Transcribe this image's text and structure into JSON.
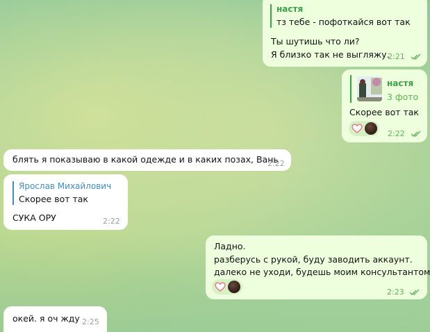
{
  "messages": [
    {
      "reply_name": "настя",
      "reply_text": "тз тебе - пофоткайся вот так",
      "line1": "Ты шутишь что ли?",
      "line2": "Я близко так не выгляжу.",
      "time": "2:21"
    },
    {
      "reply_name": "настя",
      "reply_sub": "3 фото",
      "text": "Скорее вот так",
      "time": "2:22"
    },
    {
      "text": "блять я показываю в какой одежде и в каких позах, Вань",
      "time": "2:22"
    },
    {
      "reply_name": "Ярослав Михайлович",
      "reply_text": "Скорее вот так",
      "text": "СУКА ОРУ",
      "time": "2:22"
    },
    {
      "line1": "Ладно.",
      "line2": "разберусь с рукой, буду заводить аккаунт.",
      "line3": "далеко не уходи, будешь моим консультантом.",
      "time": "2:23"
    },
    {
      "text": "окей. я оч жду",
      "time": "2:25"
    }
  ],
  "colors": {
    "outgoing_bubble": "#eeffde",
    "incoming_bubble": "#ffffff",
    "reply_green": "#3aa34a",
    "reply_blue": "#3a8ed1",
    "check_green": "#5cb455"
  },
  "icons": [
    "double-check-icon",
    "heart-reaction-icon",
    "reactor-avatar",
    "photo-thumbnail"
  ]
}
